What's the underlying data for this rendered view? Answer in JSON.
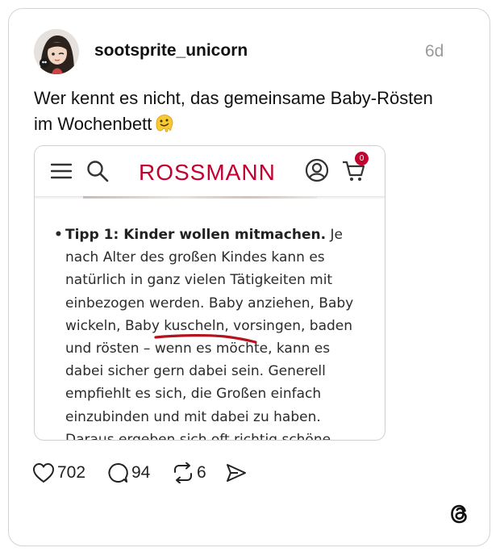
{
  "post": {
    "username": "sootsprite_unicorn",
    "time": "6d",
    "text": "Wer kennt es nicht, das gemeinsame Baby-Rösten im Wochenbett",
    "emoji": "melting-face-emoji"
  },
  "media": {
    "header": {
      "logo_text": "ROSSMANN",
      "cart_badge": "0",
      "brand_color": "#c3002f"
    },
    "article": {
      "bullet": "•",
      "heading": "Tipp 1: Kinder wollen mitmachen.",
      "body": "Je nach Alter des großen Kindes kann es natürlich in ganz vielen Tätigkeiten mit einbezogen werden. Baby anziehen, Baby wickeln, Baby kuscheln, vorsingen, baden und rösten – wenn es möchte, kann es dabei sicher gern dabei sein. Generell empfiehlt es sich, die Großen einfach einzubinden und mit dabei zu haben. Daraus ergeben sich oft richtig schöne Kuschelzeiten. Eine tolle Empfehlung für Kuschelzeiten"
    }
  },
  "actions": {
    "likes": "702",
    "comments": "94",
    "reposts": "6"
  },
  "icons": [
    "heart-icon",
    "comment-icon",
    "repost-icon",
    "share-icon",
    "threads-logo-icon",
    "menu-icon",
    "search-icon",
    "account-icon",
    "cart-icon"
  ]
}
